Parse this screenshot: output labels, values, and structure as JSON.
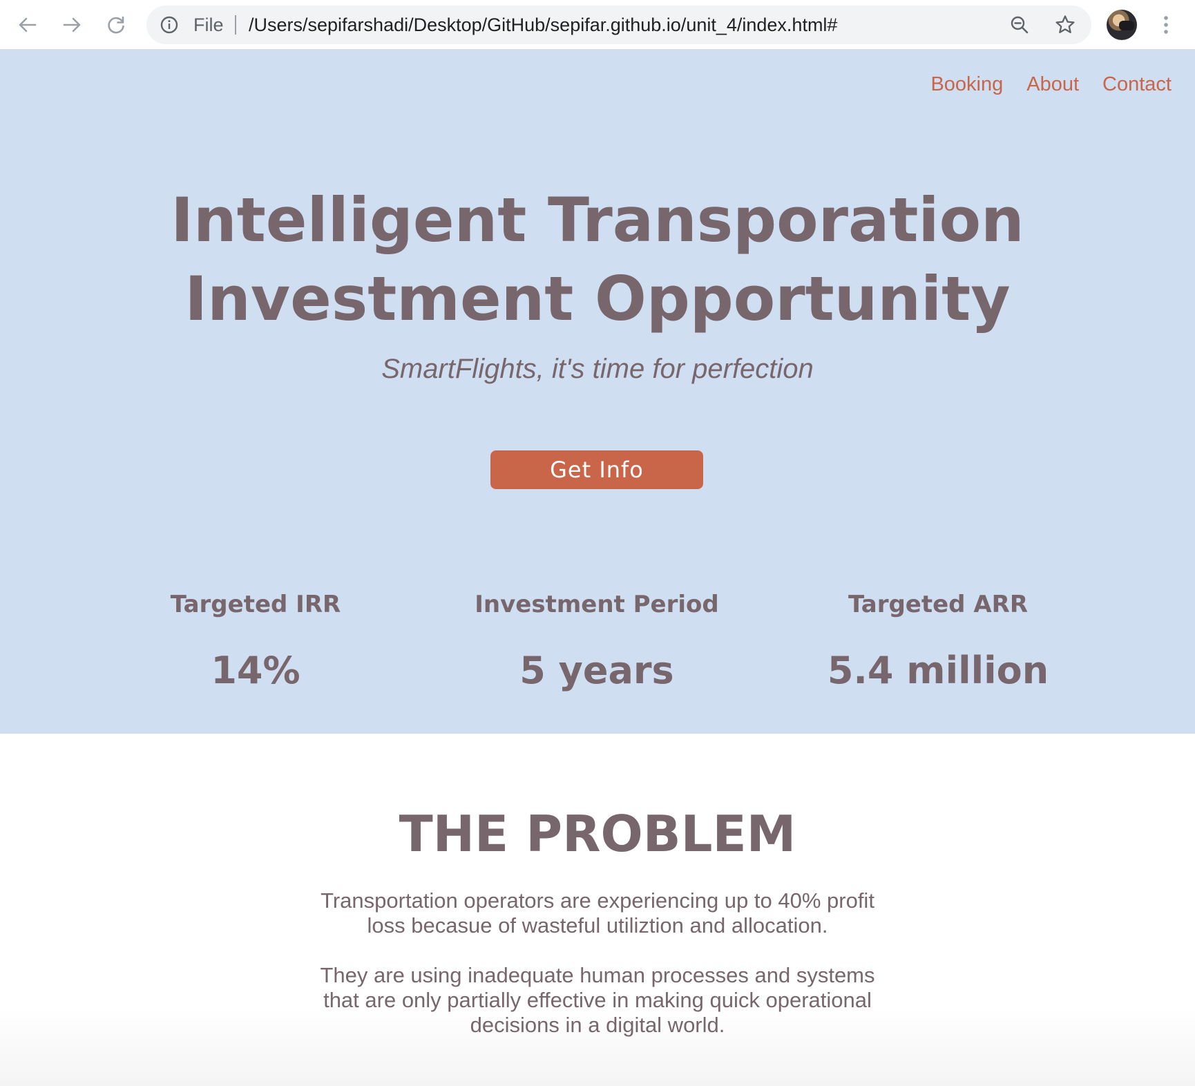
{
  "browser": {
    "scheme_label": "File",
    "url": "/Users/sepifarshadi/Desktop/GitHub/sepifar.github.io/unit_4/index.html#",
    "icons": {
      "back": "arrow-left-icon",
      "forward": "arrow-right-icon",
      "reload": "reload-icon",
      "info": "info-icon",
      "zoom": "zoom-out-icon",
      "bookmark": "star-icon",
      "menu": "kebab-menu-icon"
    }
  },
  "nav": {
    "items": [
      "Booking",
      "About",
      "Contact"
    ]
  },
  "hero": {
    "title_line1": "Intelligent Transporation",
    "title_line2": "Investment Opportunity",
    "subtitle": "SmartFlights, it's time for perfection",
    "cta_label": "Get Info"
  },
  "stats": [
    {
      "label": "Targeted IRR",
      "value": "14%"
    },
    {
      "label": "Investment Period",
      "value": "5 years"
    },
    {
      "label": "Targeted ARR",
      "value": "5.4 million"
    }
  ],
  "problem": {
    "title": "THE PROBLEM",
    "paragraph1": "Transportation operators are experiencing up to 40% profit loss becasue of wasteful utiliztion and allocation.",
    "paragraph2": "They are using inadequate human processes and systems that are only partially effective in making quick operational decisions in a digital world."
  },
  "colors": {
    "hero_bg": "#cfdef0",
    "accent": "#c9664a",
    "text": "#78666d"
  }
}
